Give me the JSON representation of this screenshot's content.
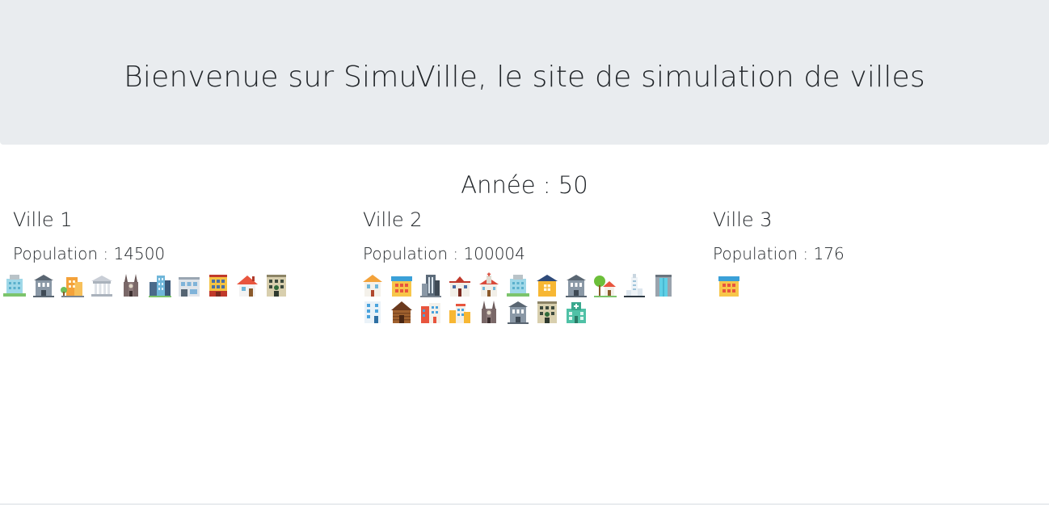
{
  "header": {
    "title": "Bienvenue sur SimuVille, le site de simulation de villes"
  },
  "simulation": {
    "year_label": "Année : 50"
  },
  "cities": [
    {
      "name": "Ville 1",
      "population_label": "Population : 14500",
      "buildings": [
        "office-tower-icon",
        "bank-icon",
        "factory-icon",
        "museum-icon",
        "cathedral-icon",
        "skyscrapers-icon",
        "shop-block-icon",
        "apartment-icon",
        "house-icon",
        "hotel-icon"
      ]
    },
    {
      "name": "Ville 2",
      "population_label": "Population : 100004",
      "buildings": [
        "townhouse-icon",
        "store-icon",
        "tall-tower-icon",
        "school-icon",
        "church-icon",
        "office-tower-icon",
        "yellow-house-icon",
        "bank-icon",
        "tree-house-icon",
        "lighthouse-tower-icon",
        "glass-office-icon",
        "blue-apartment-icon",
        "log-cabin-icon",
        "red-apartment-icon",
        "small-shop-icon",
        "cathedral-icon",
        "bank-icon",
        "hotel-icon",
        "hospital-icon"
      ]
    },
    {
      "name": "Ville 3",
      "population_label": "Population : 176",
      "buildings": [
        "store-icon"
      ]
    }
  ]
}
